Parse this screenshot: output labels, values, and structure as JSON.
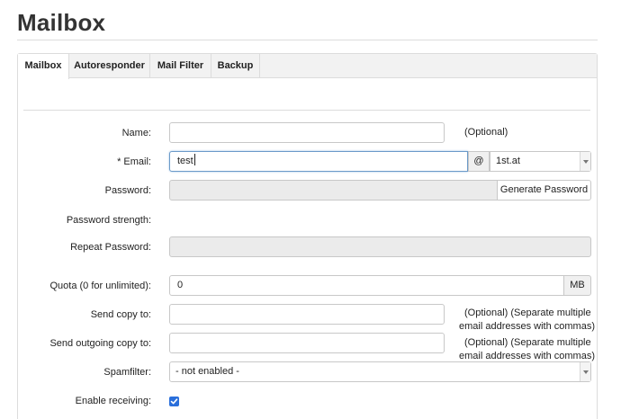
{
  "page": {
    "title": "Mailbox"
  },
  "tabs": [
    {
      "label": "Mailbox",
      "active": true
    },
    {
      "label": "Autoresponder",
      "active": false
    },
    {
      "label": "Mail Filter",
      "active": false
    },
    {
      "label": "Backup",
      "active": false
    }
  ],
  "form": {
    "name": {
      "label": "Name:",
      "value": "",
      "hint": "(Optional)"
    },
    "email": {
      "label": "* Email:",
      "value": "test",
      "at_sign": "@",
      "domain": "1st.at"
    },
    "password": {
      "label": "Password:",
      "value": "",
      "generate_label": "Generate Password"
    },
    "password_strength": {
      "label": "Password strength:"
    },
    "repeat_password": {
      "label": "Repeat Password:",
      "value": ""
    },
    "quota": {
      "label": "Quota (0 for unlimited):",
      "value": "0",
      "unit": "MB"
    },
    "send_copy": {
      "label": "Send copy to:",
      "value": "",
      "hint_line1": "(Optional) (Separate multiple",
      "hint_line2": "email addresses with commas)"
    },
    "send_outgoing_copy": {
      "label": "Send outgoing copy to:",
      "value": "",
      "hint_line1": "(Optional) (Separate multiple",
      "hint_line2": "email addresses with commas)"
    },
    "spamfilter": {
      "label": "Spamfilter:",
      "selected": "- not enabled -"
    },
    "enable_receiving": {
      "label": "Enable receiving:",
      "checked": true
    }
  },
  "colors": {
    "accent": "#2a6fdb",
    "focus_border": "#6b9ac9",
    "disabled_bg": "#ebebeb"
  }
}
